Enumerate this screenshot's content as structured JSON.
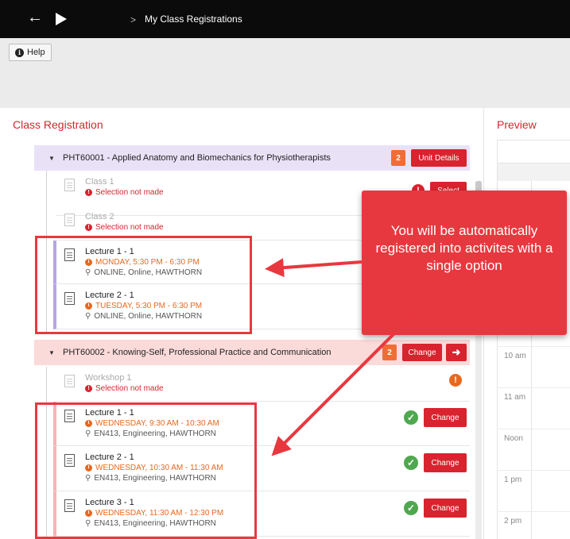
{
  "header": {
    "back_icon": "back-arrow-icon",
    "breadcrumb_separator": ">",
    "breadcrumb": "My Class Registrations"
  },
  "toolbar": {
    "help_label": "Help",
    "help_icon": "info-icon"
  },
  "left_panel": {
    "title": "Class Registration"
  },
  "right_panel": {
    "title": "Preview",
    "time_labels": [
      "10 am",
      "11 am",
      "Noon",
      "1 pm",
      "2 pm"
    ]
  },
  "units": [
    {
      "code_title": "PHT60001 - Applied Anatomy and Biomechanics for Physiotherapists",
      "badge": "2",
      "button": "Unit Details",
      "classes": [
        {
          "name": "Class 1",
          "status": "Selection not made",
          "action": "Select"
        },
        {
          "name": "Class 2",
          "status": "Selection not made"
        },
        {
          "name": "Lecture 1 - 1",
          "time": "MONDAY, 5:30 PM - 6:30 PM",
          "location": "ONLINE, Online, HAWTHORN"
        },
        {
          "name": "Lecture 2 - 1",
          "time": "TUESDAY, 5:30 PM - 6:30 PM",
          "location": "ONLINE, Online, HAWTHORN"
        }
      ]
    },
    {
      "code_title": "PHT60002 - Knowing-Self, Professional Practice and Communication",
      "badge": "2",
      "button": "Change",
      "classes": [
        {
          "name": "Workshop 1",
          "status": "Selection not made"
        },
        {
          "name": "Lecture 1 - 1",
          "time": "WEDNESDAY, 9:30 AM - 10:30 AM",
          "location": "EN413, Engineering, HAWTHORN",
          "action": "Change"
        },
        {
          "name": "Lecture 2 - 1",
          "time": "WEDNESDAY, 10:30 AM - 11:30 AM",
          "location": "EN413, Engineering, HAWTHORN",
          "action": "Change"
        },
        {
          "name": "Lecture 3 - 1",
          "time": "WEDNESDAY, 11:30 AM - 12:30 PM",
          "location": "EN413, Engineering, HAWTHORN",
          "action": "Change"
        }
      ]
    }
  ],
  "callout": {
    "text": "You will be automatically registered into activites with a single option"
  },
  "colors": {
    "accent_red": "#d9232e",
    "badge_orange": "#f36c35",
    "time_orange": "#e8681e",
    "success_green": "#4fa84f",
    "purple_bg": "#e9e2f7",
    "pink_bg": "#fbdada",
    "callout_red": "#e8383f"
  }
}
